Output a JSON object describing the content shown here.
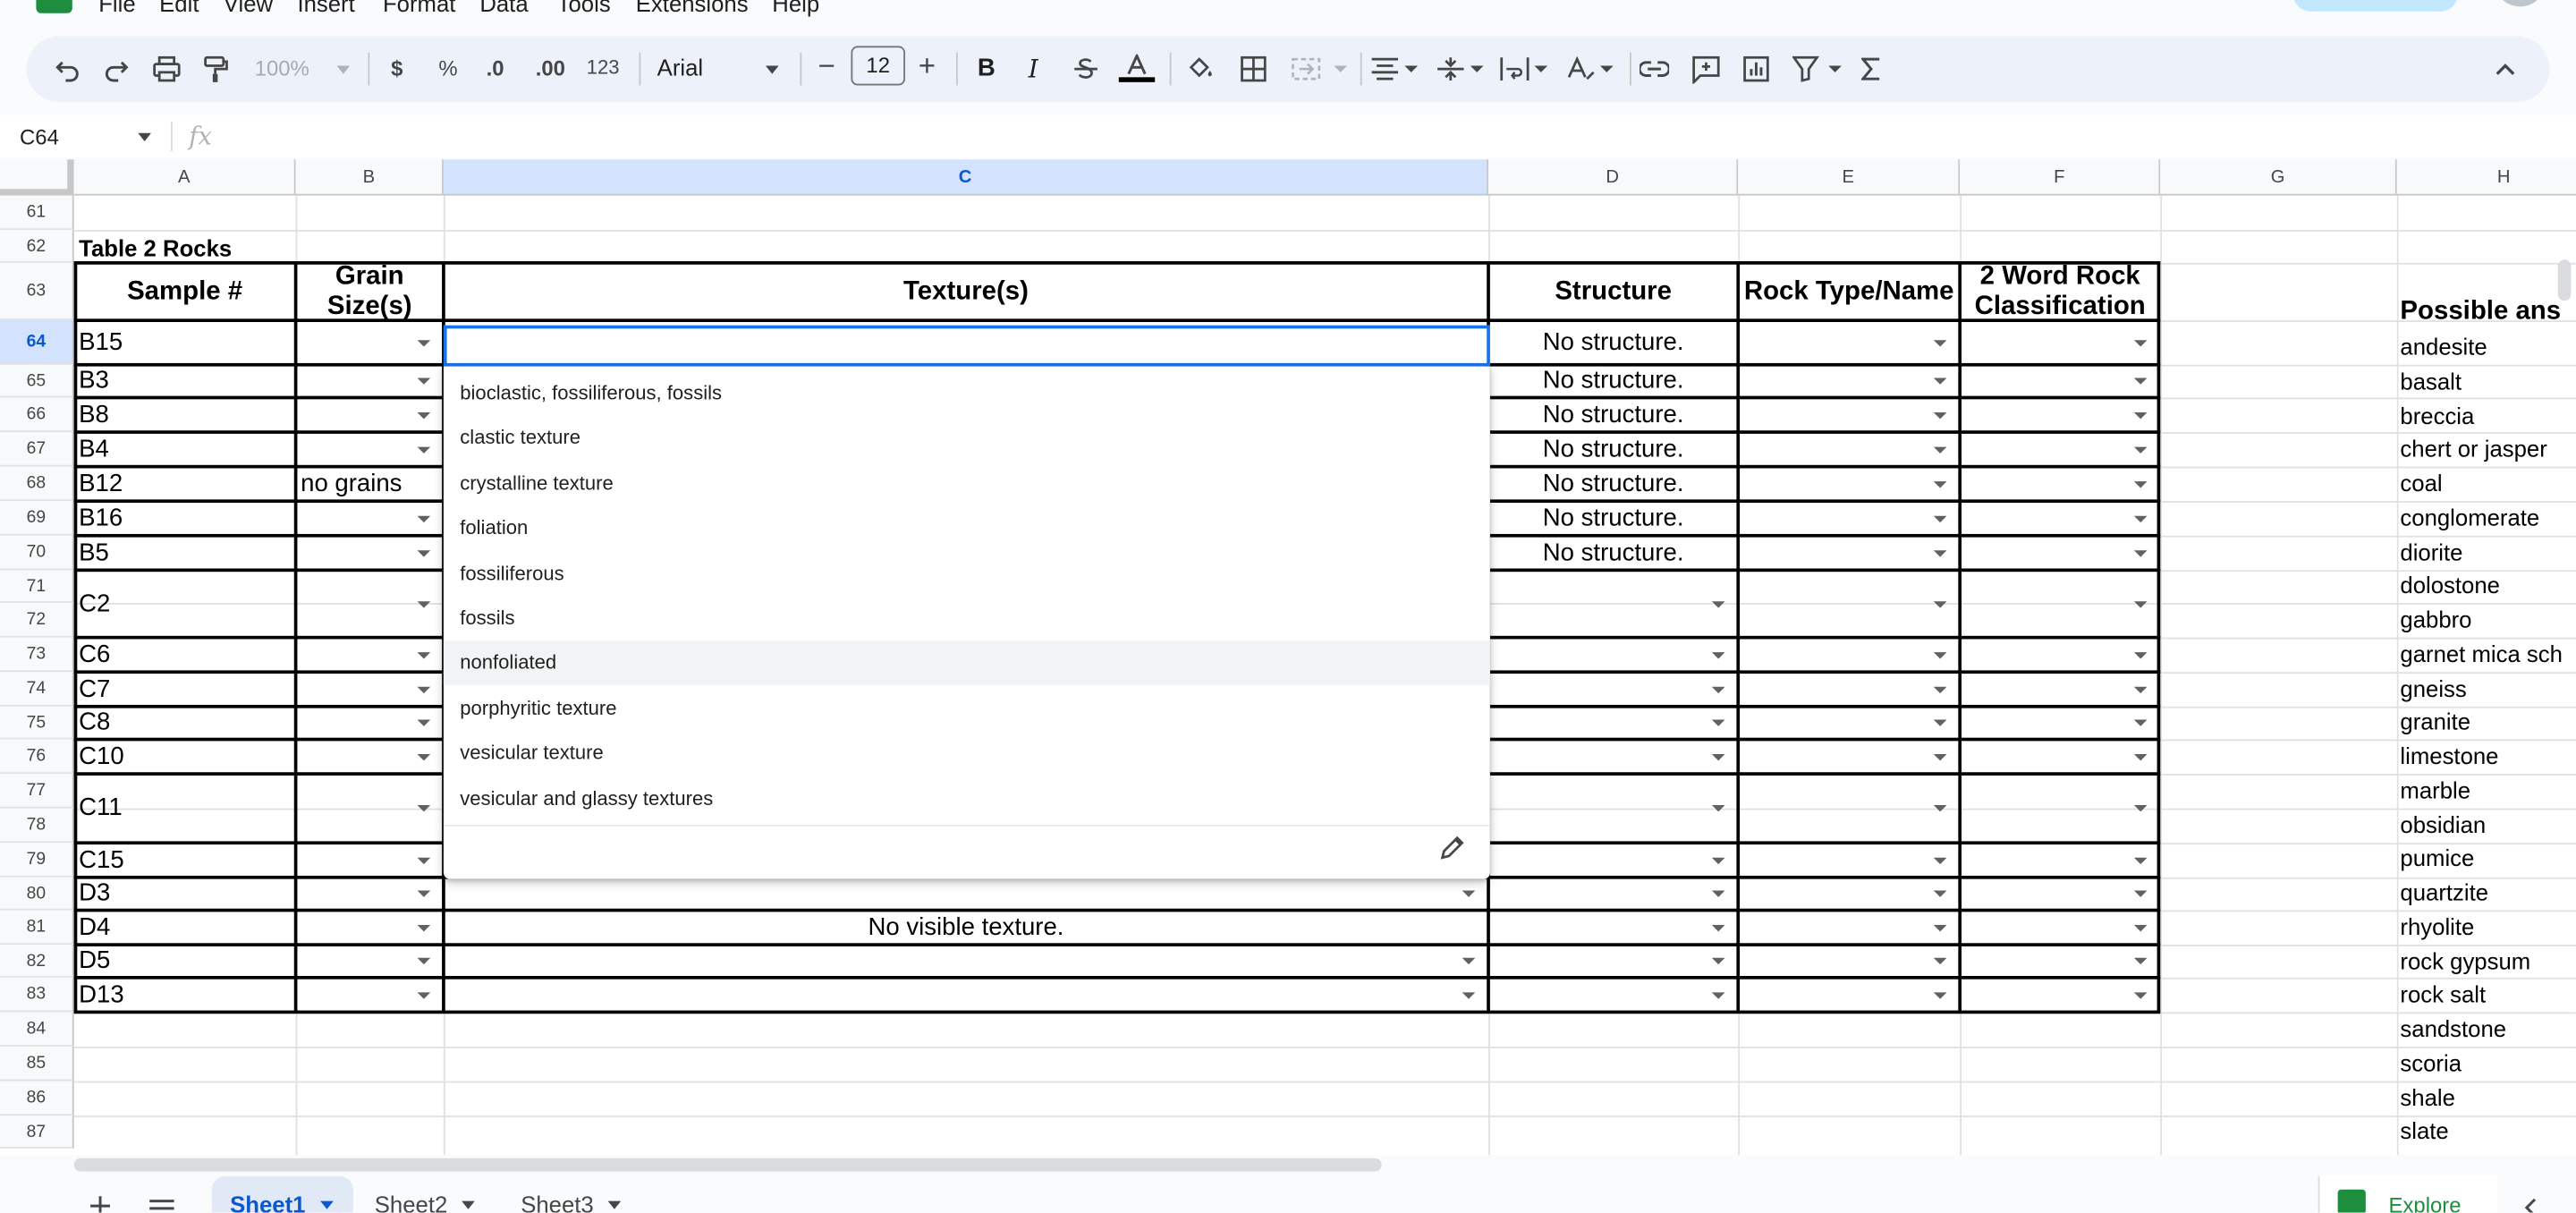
{
  "menu": [
    "File",
    "Edit",
    "View",
    "Insert",
    "Format",
    "Data",
    "Tools",
    "Extensions",
    "Help"
  ],
  "toolbar": {
    "zoom": "100%",
    "currency": "$",
    "percent": "%",
    "decrease_decimal": ".0",
    "increase_decimal": ".00",
    "number_format": "123",
    "font": "Arial",
    "font_size": "12",
    "minus": "−",
    "plus": "+",
    "bold": "B",
    "italic": "I"
  },
  "formula_bar": {
    "cell_ref": "C64",
    "fx": "fx",
    "content": ""
  },
  "columns": [
    "A",
    "B",
    "C",
    "D",
    "E",
    "F",
    "G",
    "H"
  ],
  "rows": [
    "61",
    "62",
    "63",
    "64",
    "65",
    "66",
    "67",
    "68",
    "69",
    "70",
    "71",
    "72",
    "73",
    "74",
    "75",
    "76",
    "77",
    "78",
    "79",
    "80",
    "81",
    "82",
    "83",
    "84",
    "85",
    "86",
    "87"
  ],
  "table": {
    "title": "Table 2 Rocks",
    "headers": {
      "sample": "Sample #",
      "grain_1": "Grain",
      "grain_2": "Size(s)",
      "texture": "Texture(s)",
      "structure": "Structure",
      "rock_type": "Rock Type/Name",
      "class_1": "2 Word Rock",
      "class_2": "Classification"
    },
    "samples": [
      "B15",
      "B3",
      "B8",
      "B4",
      "B12",
      "B16",
      "B5",
      "C2",
      "C6",
      "C7",
      "C8",
      "C10",
      "C11",
      "C15",
      "D3",
      "D4",
      "D5",
      "D13"
    ],
    "grain_b12": "no grains",
    "structure_text": "No structure.",
    "texture_d4": "No visible texture."
  },
  "answers": {
    "header": "Possible ans",
    "items": [
      "andesite",
      "basalt",
      "breccia",
      "chert or jasper",
      "coal",
      "conglomerate",
      "diorite",
      "dolostone",
      "gabbro",
      "garnet mica sch",
      "gneiss",
      "granite",
      "limestone",
      "marble",
      "obsidian",
      "pumice",
      "quartzite",
      "rhyolite",
      "rock gypsum",
      "rock salt",
      "sandstone",
      "scoria",
      "shale",
      "slate"
    ]
  },
  "dropdown": {
    "options": [
      "bioclastic, fossiliferous, fossils",
      "clastic texture",
      "crystalline texture",
      "foliation",
      "fossiliferous",
      "fossils",
      "nonfoliated",
      "porphyritic texture",
      "vesicular texture",
      "vesicular and glassy textures"
    ],
    "highlighted": "nonfoliated"
  },
  "sheets": [
    "Sheet1",
    "Sheet2",
    "Sheet3"
  ],
  "active_sheet": "Sheet1",
  "explore_label": "Explore",
  "colors": {
    "selection": "#1a73e8",
    "header_selected": "#d3e3fd",
    "brand_green": "#1e8e3e"
  }
}
